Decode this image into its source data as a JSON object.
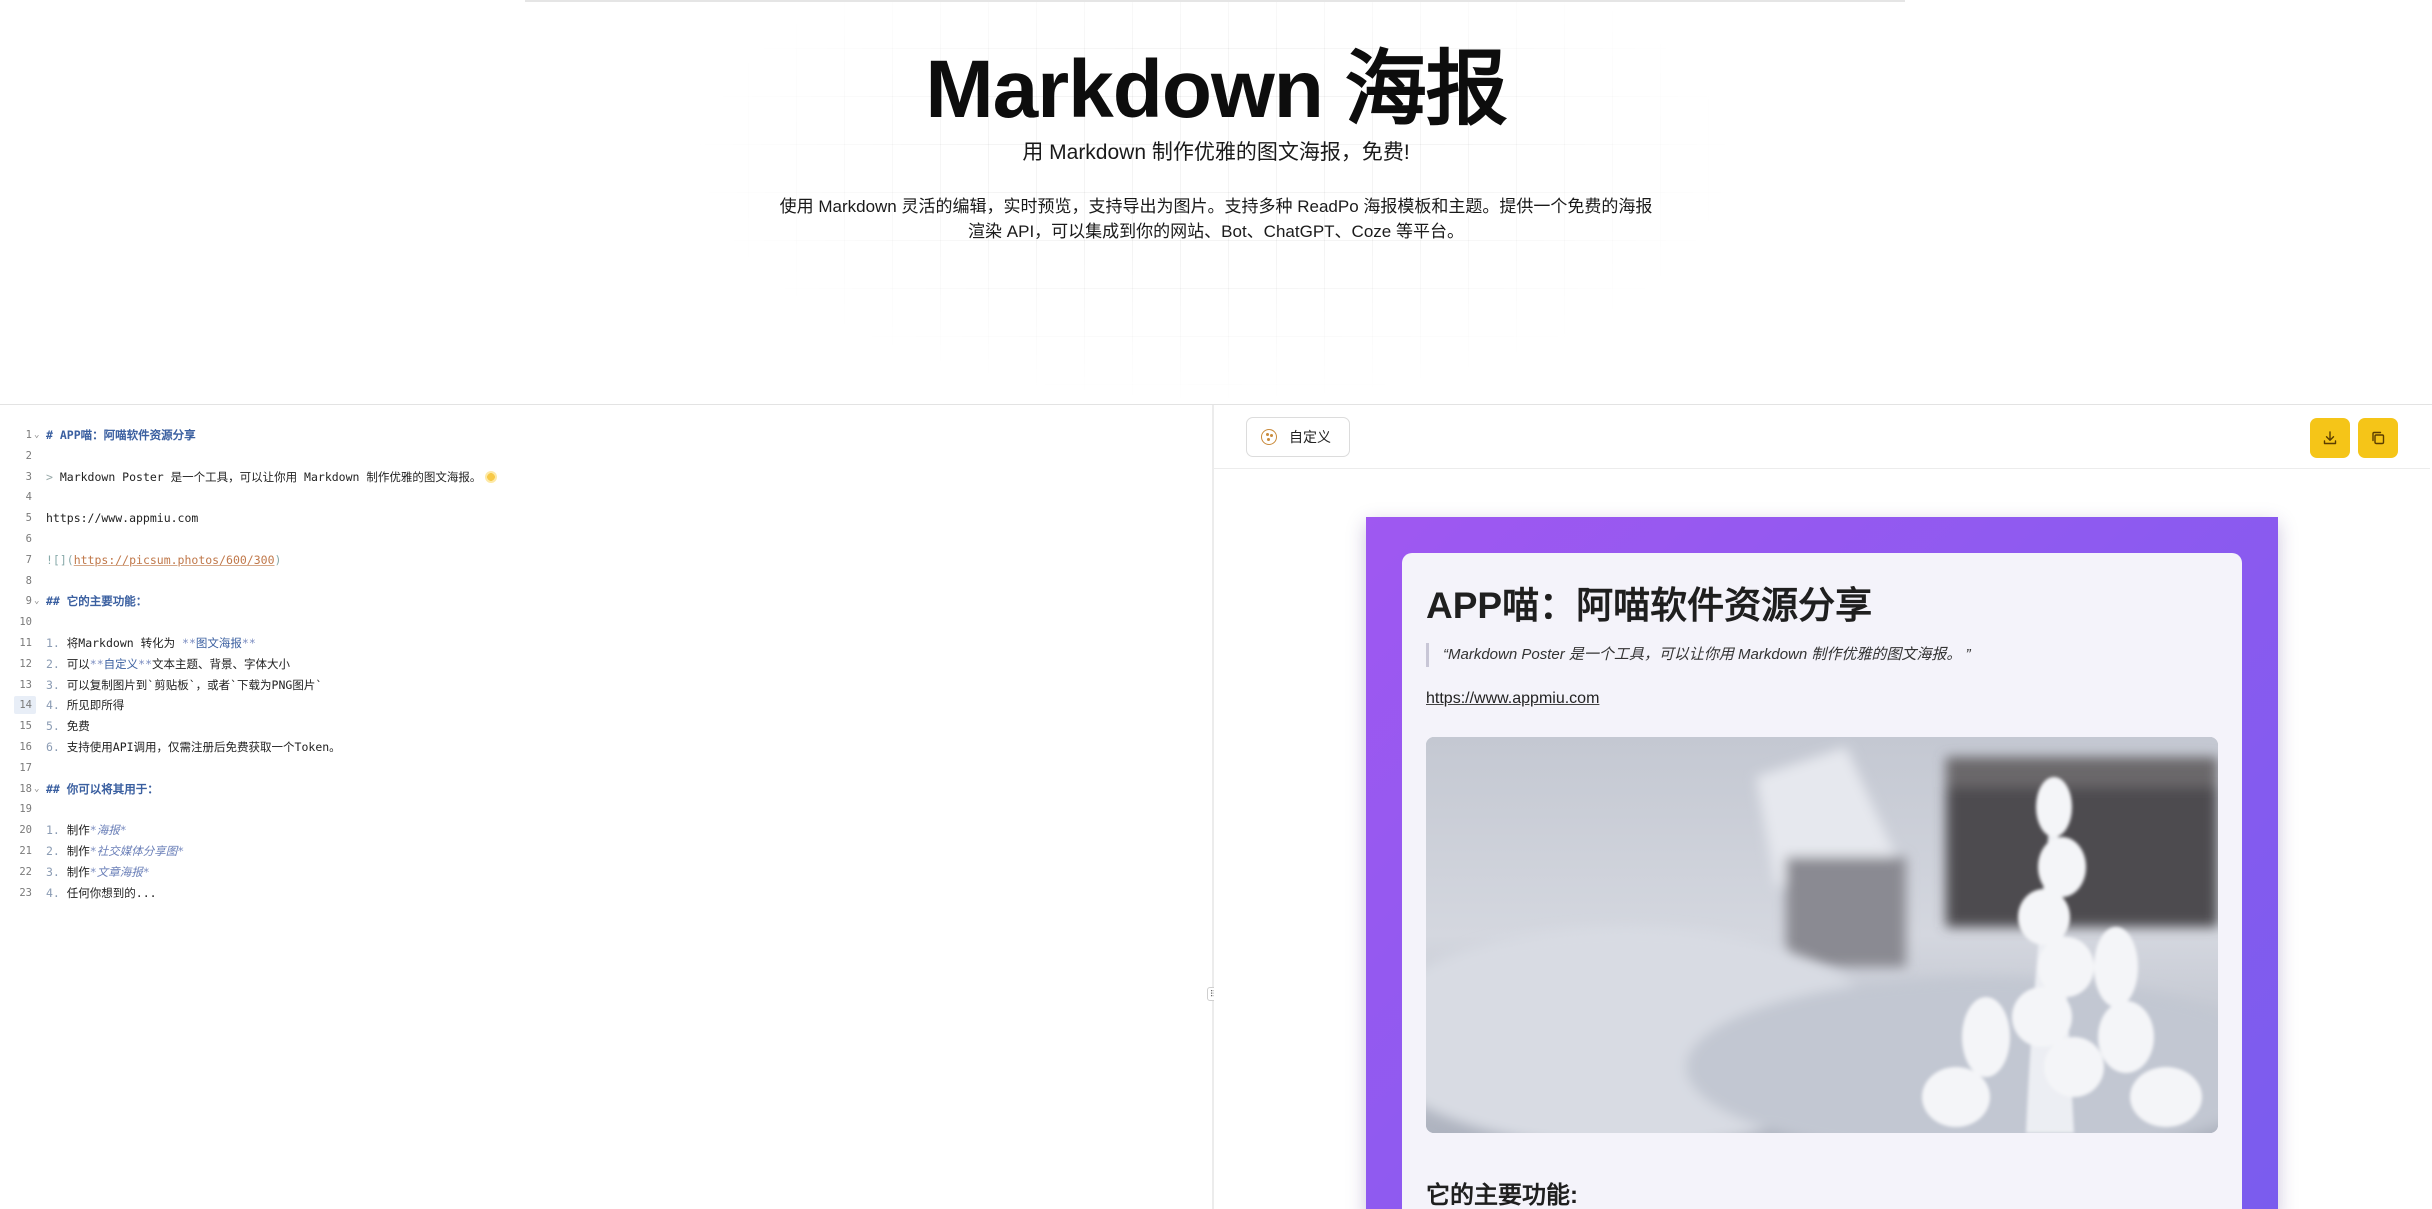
{
  "hero": {
    "title": "Markdown 海报",
    "subtitle": "用 Markdown 制作优雅的图文海报，免费!",
    "description": "使用 Markdown 灵活的编辑，实时预览，支持导出为图片。支持多种 ReadPo 海报模板和主题。提供一个免费的海报渲染 API，可以集成到你的网站、Bot、ChatGPT、Coze 等平台。"
  },
  "editor": {
    "active_line": 14,
    "lines": [
      {
        "n": "1",
        "fold": true,
        "text": "# APP喵：阿喵软件资源分享"
      },
      {
        "n": "2",
        "text": ""
      },
      {
        "n": "3",
        "text": "> Markdown Poster 是一个工具，可以让你用 Markdown 制作优雅的图文海报。"
      },
      {
        "n": "4",
        "text": ""
      },
      {
        "n": "5",
        "text": "https://www.appmiu.com"
      },
      {
        "n": "6",
        "text": ""
      },
      {
        "n": "7",
        "text": "![](https://picsum.photos/600/300)"
      },
      {
        "n": "8",
        "text": ""
      },
      {
        "n": "9",
        "fold": true,
        "text": "## 它的主要功能："
      },
      {
        "n": "10",
        "text": ""
      },
      {
        "n": "11",
        "text": "1. 将Markdown 转化为 **图文海报**"
      },
      {
        "n": "12",
        "text": "2. 可以**自定义**文本主题、背景、字体大小"
      },
      {
        "n": "13",
        "text": "3. 可以复制图片到`剪贴板`，或者`下载为PNG图片`"
      },
      {
        "n": "14",
        "text": "4. 所见即所得"
      },
      {
        "n": "15",
        "text": "5. 免费"
      },
      {
        "n": "16",
        "text": "6. 支持使用API调用，仅需注册后免费获取一个Token。"
      },
      {
        "n": "17",
        "text": ""
      },
      {
        "n": "18",
        "fold": true,
        "text": "## 你可以将其用于："
      },
      {
        "n": "19",
        "text": ""
      },
      {
        "n": "20",
        "text": "1. 制作*海报*"
      },
      {
        "n": "21",
        "text": "2. 制作*社交媒体分享图*"
      },
      {
        "n": "22",
        "text": "3. 制作*文章海报*"
      },
      {
        "n": "23",
        "text": "4. 任何你想到的..."
      }
    ]
  },
  "toolbar": {
    "custom_label": "自定义",
    "download_icon": "download-icon",
    "copy_icon": "copy-icon",
    "accent": "#f5c518"
  },
  "poster": {
    "gradient_start": "#9f58f1",
    "gradient_end": "#7a5cee",
    "title": "APP喵：阿喵软件资源分享",
    "quote": "“Markdown Poster 是一个工具，可以让你用 Markdown 制作优雅的图文海报。 ”",
    "link": "https://www.appmiu.com",
    "image_alt": "frosted-plants-photo",
    "section_title": "它的主要功能:"
  }
}
